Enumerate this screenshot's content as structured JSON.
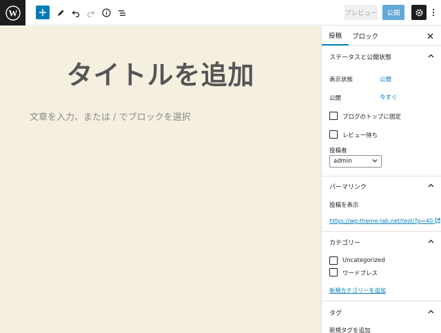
{
  "toolbar": {
    "preview_label": "プレビュー",
    "publish_label": "公開"
  },
  "canvas": {
    "title_placeholder": "タイトルを追加",
    "body_placeholder": "文章を入力、または / でブロックを選択"
  },
  "sidebar": {
    "tabs": [
      {
        "label": "投稿",
        "active": true
      },
      {
        "label": "ブロック",
        "active": false
      }
    ],
    "status_panel": {
      "title": "ステータスと公開状態",
      "visibility_label": "表示状態",
      "visibility_value": "公開",
      "publish_label": "公開",
      "publish_value": "今すぐ",
      "sticky_label": "ブログのトップに固定",
      "pending_label": "レビュー待ち",
      "author_label": "投稿者",
      "author_value": "admin"
    },
    "permalink_panel": {
      "title": "パーマリンク",
      "view_label": "投稿を表示",
      "url": "https://wp-theme-lab.net/test/?p=40"
    },
    "category_panel": {
      "title": "カテゴリー",
      "items": [
        "Uncategorized",
        "ワードプレス"
      ],
      "add_link": "新規カテゴリーを追加"
    },
    "tag_panel": {
      "title": "タグ",
      "add_label": "新規タグを追加"
    }
  },
  "colors": {
    "accent": "#007cba",
    "canvas_bg": "#f5efe0",
    "dark": "#1e1e1e"
  },
  "icons": [
    "wordpress-logo",
    "plus-icon",
    "pen-icon",
    "undo-icon",
    "redo-icon",
    "info-icon",
    "list-view-icon",
    "gear-icon",
    "more-vertical-icon",
    "external-link-icon",
    "chevron-up-icon",
    "close-icon",
    "chevron-down-icon"
  ]
}
